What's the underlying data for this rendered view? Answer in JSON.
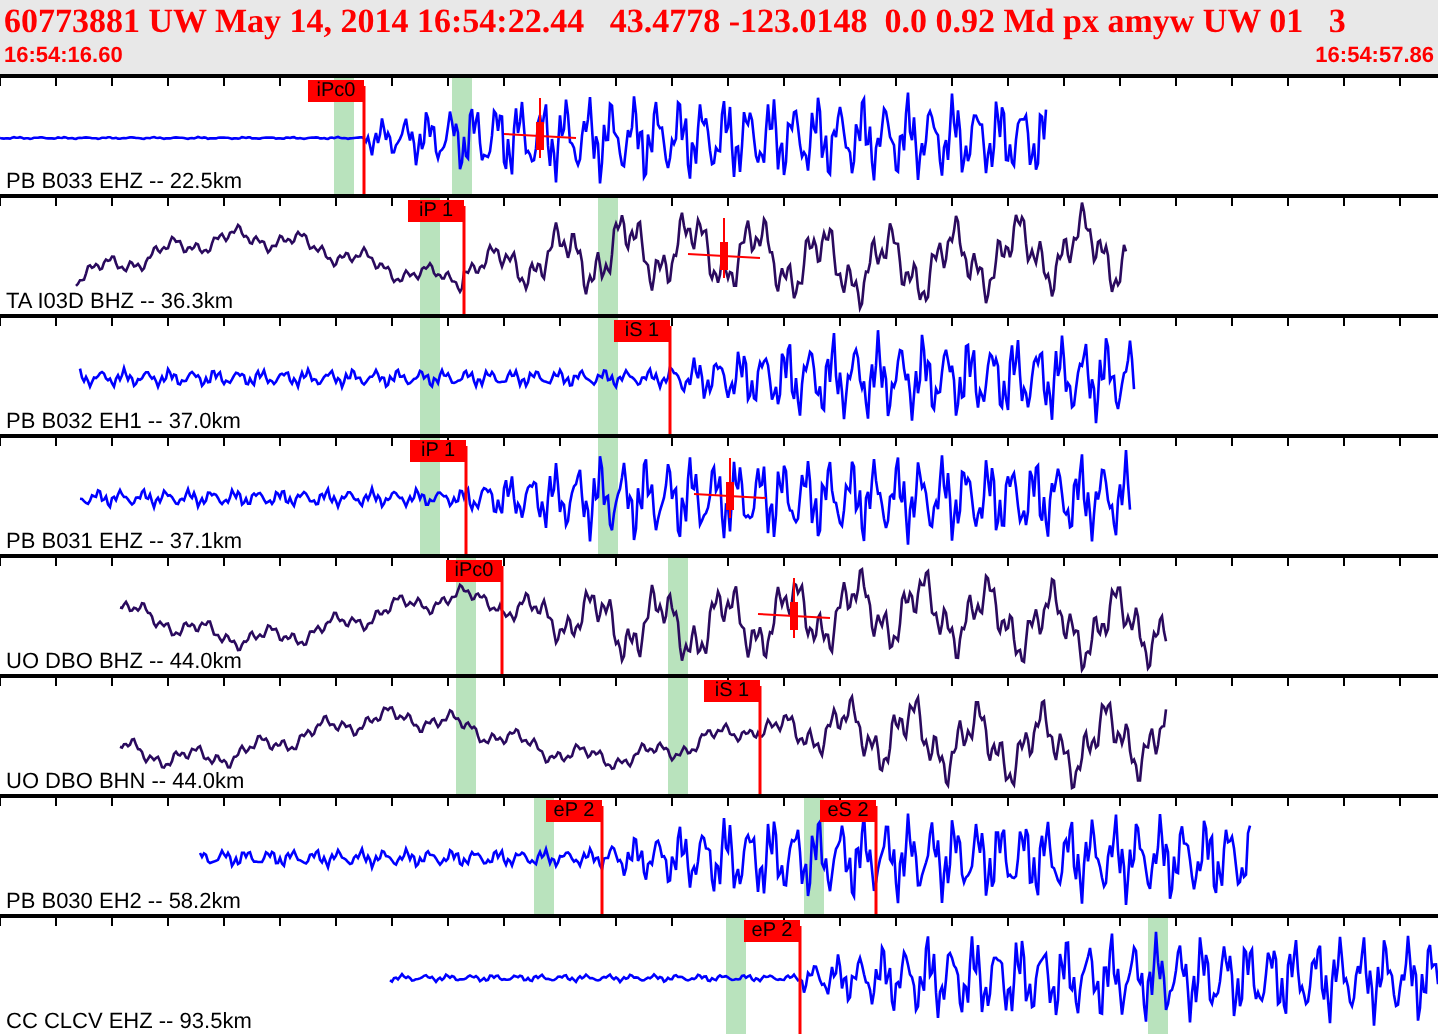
{
  "header": {
    "event_line": "60773881 UW May 14, 2014 16:54:22.44   43.4778 -123.0148  0.0 0.92 Md px amyw UW 01   3",
    "start_time": "16:54:16.60",
    "end_time": "16:54:57.86"
  },
  "traces": [
    {
      "label": "PB B033 EHZ -- 22.5km",
      "color": "#0000ff",
      "picks": [
        {
          "label": "iPc0"
        }
      ]
    },
    {
      "label": "TA I03D BHZ -- 36.3km",
      "color": "#2a0a5e",
      "picks": [
        {
          "label": "iP 1"
        }
      ]
    },
    {
      "label": "PB B032 EH1 -- 37.0km",
      "color": "#0000ff",
      "picks": [
        {
          "label": "iS 1"
        }
      ]
    },
    {
      "label": "PB B031 EHZ -- 37.1km",
      "color": "#0000ff",
      "picks": [
        {
          "label": "iP 1"
        }
      ]
    },
    {
      "label": "UO DBO BHZ -- 44.0km",
      "color": "#2a0a5e",
      "picks": [
        {
          "label": "iPc0"
        }
      ]
    },
    {
      "label": "UO DBO BHN -- 44.0km",
      "color": "#2a0a5e",
      "picks": [
        {
          "label": "iS 1"
        }
      ]
    },
    {
      "label": "PB B030 EH2 -- 58.2km",
      "color": "#0000ff",
      "picks": [
        {
          "label": "eP 2"
        },
        {
          "label": "eS 2"
        }
      ]
    },
    {
      "label": "CC CLCV EHZ -- 93.5km",
      "color": "#0000ff",
      "picks": [
        {
          "label": "eP 2"
        }
      ]
    }
  ]
}
